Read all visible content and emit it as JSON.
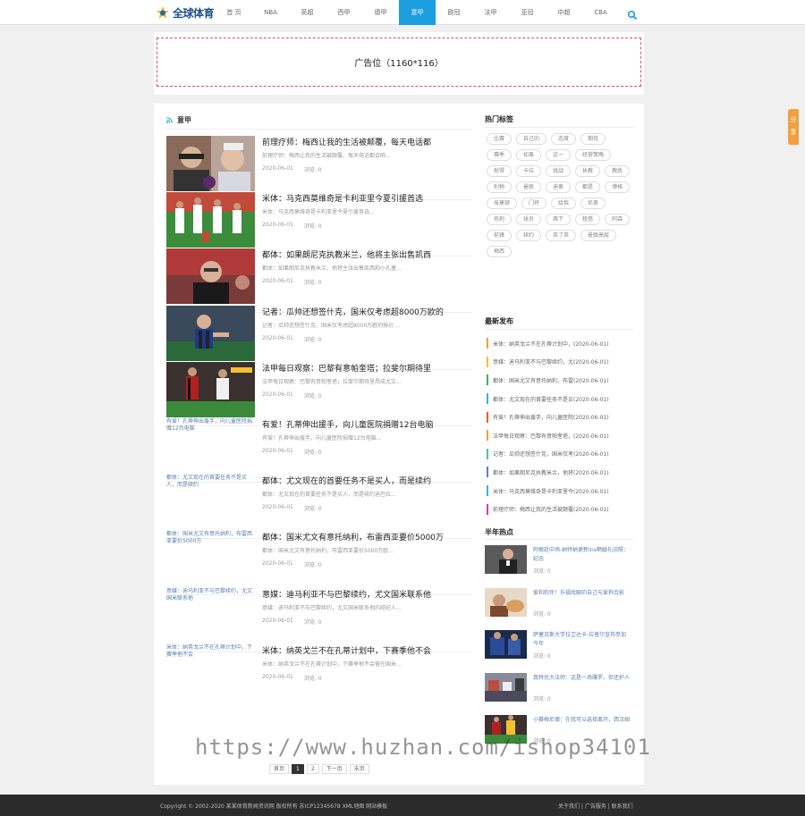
{
  "site": {
    "logo_text": "全球体育"
  },
  "nav": [
    "首 页",
    "NBA",
    "英超",
    "西甲",
    "德甲",
    "意甲",
    "欧冠",
    "法甲",
    "亚冠",
    "中超",
    "CBA"
  ],
  "nav_active_index": 5,
  "ad_text": "广告位（1160*116）",
  "section_title": "意甲",
  "articles": [
    {
      "title": "前理疗师：梅西让我的生活被颠覆，每天电话都",
      "excerpt": "前理疗师：梅西让我的生活被颠覆，每天电话都会响...",
      "date": "2020-06-01",
      "views": "浏览: 0",
      "thumb": "img"
    },
    {
      "title": "米体：马克西莫维奇是卡利亚里今夏引援首选",
      "excerpt": "米体：马克西莫维奇是卡利亚里今夏引援首选...",
      "date": "2020-06-01",
      "views": "浏览: 0",
      "thumb": "img"
    },
    {
      "title": "都体：如果朗尼克执教米兰，他将主张出售凯西",
      "excerpt": "都体：如果朗尼克执教米兰，他将主张出售凯西和小孔塞...",
      "date": "2020-06-01",
      "views": "浏览: 0",
      "thumb": "img"
    },
    {
      "title": "记者：瓜帅还想签什克，国米仅考虑超8000万欧的",
      "excerpt": "记者：瓜帅还想签什克，国米仅考虑超8000万欧的报价...",
      "date": "2020-06-01",
      "views": "浏览: 0",
      "thumb": "img"
    },
    {
      "title": "法甲每日观察：巴黎有意帕奎塔；拉斐尔期待里",
      "excerpt": "法甲每日观察：巴黎有意帕奎塔；拉斐尔期待里昂成尤文...",
      "date": "2020-06-01",
      "views": "浏览: 0",
      "thumb": "img"
    },
    {
      "title": "有爱！孔蒂伸出援手，向儿童医院捐赠12台电脑",
      "excerpt": "有爱！孔蒂伸出援手，向儿童医院捐赠12台电脑...",
      "date": "2020-06-01",
      "views": "浏览: 0",
      "thumb": "alt",
      "alt": "有爱！孔蒂伸出援手，向儿童医院捐赠12台电脑"
    },
    {
      "title": "都体：尤文现在的首要任务不是买人，而是续约",
      "excerpt": "都体：尤文现在的首要任务不是买人，而是续约迪巴拉...",
      "date": "2020-06-01",
      "views": "浏览: 0",
      "thumb": "alt",
      "alt": "都体：尤文现在的首要任务不是买人，而是续约"
    },
    {
      "title": "都体：国米尤文有意托纳利，布雷西亚要价5000万",
      "excerpt": "都体：国米尤文有意托纳利，布雷西亚要价5000万欧...",
      "date": "2020-06-01",
      "views": "浏览: 0",
      "thumb": "alt",
      "alt": "都体：国米尤文有意托纳利，布雷西亚要价5000万"
    },
    {
      "title": "意媒：迪马利亚不与巴黎续约，尤文国米联系他",
      "excerpt": "意媒：迪马利亚不与巴黎续约，尤文国米联系他的经纪人...",
      "date": "2020-06-01",
      "views": "浏览: 0",
      "thumb": "alt",
      "alt": "意媒：迪马利亚不与巴黎续约，尤文国米联系他"
    },
    {
      "title": "米体：纳英戈兰不在孔蒂计划中，下赛季他不会",
      "excerpt": "米体：纳英戈兰不在孔蒂计划中，下赛季他不会留在国米...",
      "date": "2020-06-01",
      "views": "浏览: 0",
      "thumb": "alt",
      "alt": "米体：纳英戈兰不在孔蒂计划中，下赛季他不会"
    }
  ],
  "pager": {
    "first": "首页",
    "pages": [
      "1",
      "2"
    ],
    "next": "下一页",
    "last": "末页"
  },
  "hot_tags_title": "热门标签",
  "tags": [
    "比赛",
    "自己的",
    "态度",
    "期待",
    "赛季",
    "如果",
    "这一",
    "经营策略",
    "就得",
    "卡拉",
    "挑战",
    "执教",
    "教练",
    "利物",
    "曼联",
    "迪奥",
    "都是",
    "博格",
    "埃莫顿",
    "门将",
    "给我",
    "尼奥",
    "热刺",
    "球员",
    "茜下",
    "租借",
    "阿森",
    "前锋",
    "续约",
    "英了英",
    "曼联高层",
    "梅西"
  ],
  "recent_title": "最新发布",
  "recent": [
    {
      "text": "米体：纳英戈兰不在孔蒂计划中，(2020-06-01)",
      "color": "#f0a040"
    },
    {
      "text": "意媒：迪马利亚不与巴黎续约，尤(2020-06-01)",
      "color": "#f5c030"
    },
    {
      "text": "都体：国米尤文有意托纳利，布雷(2020-06-01)",
      "color": "#40b060"
    },
    {
      "text": "都体：尤文现在的首要任务不是买(2020-06-01)",
      "color": "#30b8d8"
    },
    {
      "text": "有爱！孔蒂伸出援手，向儿童医院(2020-06-01)",
      "color": "#e06030"
    },
    {
      "text": "法甲每日观察：巴黎有意帕奎塔，(2020-06-01)",
      "color": "#f0a040"
    },
    {
      "text": "记者：瓜帅还想签什克，国米仅考(2020-06-01)",
      "color": "#50c0a0"
    },
    {
      "text": "都体：如果朗尼克执教米兰，他将(2020-06-01)",
      "color": "#6a78d0"
    },
    {
      "text": "米体：马克西莫维奇是卡利亚里今(2020-06-01)",
      "color": "#30b8d8"
    },
    {
      "text": "前理疗师：梅西让我的生活被颠覆(2020-06-01)",
      "color": "#d040a0"
    }
  ],
  "hot_title": "半年热点",
  "hot": [
    {
      "title": "阿根廷中场-纳特纳更新Ins晒婚礼旧照：纪念",
      "views": "浏览: 0"
    },
    {
      "title": "爱和和伴！乐福找聊的自己与爱狗合影",
      "views": "浏览: 0"
    },
    {
      "title": "萨塞克斯大学拉卫达卡-拉普尔宣布参加今年",
      "views": "浏览: 0"
    },
    {
      "title": "真特优大法师：这是一场赚罗，但还护人",
      "views": "浏览: 0"
    },
    {
      "title": "小赛梅尼德：在我可以选择离开，西汉姆",
      "views": "浏览: 0"
    }
  ],
  "share_text": "分享",
  "footer": {
    "left": "Copyright © 2002-2020 某某体育新闻资讯网 版权所有 苏ICP12345678 XML地图 网站模板",
    "right": "关于我们 | 广告服务 | 联系我们"
  },
  "watermark": "https://www.huzhan.com/ishop34101",
  "colors": {
    "accent": "#1a9ee0",
    "footer": "#2b2b2b",
    "share": "#f0a040"
  }
}
